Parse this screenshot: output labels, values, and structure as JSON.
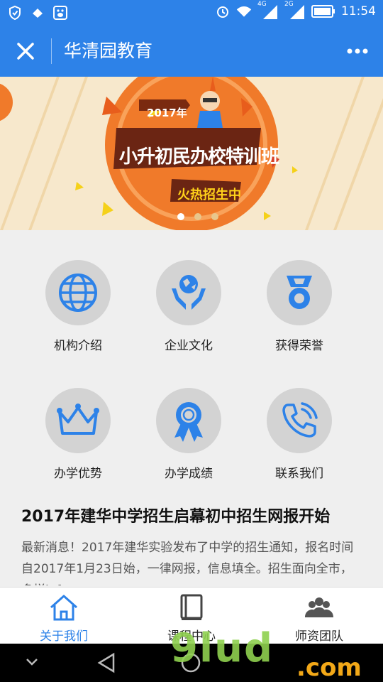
{
  "status_bar": {
    "time": "11:54",
    "network_1": "4G",
    "network_2": "2G",
    "icons": [
      "shield-icon",
      "notification-icon",
      "baidu-icon",
      "alarm-icon",
      "wifi-icon",
      "signal-icon",
      "battery-icon"
    ]
  },
  "app_bar": {
    "title": "华清园教育",
    "close_icon": "close-icon",
    "more_icon": "more-icon",
    "color": "#2d82e8"
  },
  "banner": {
    "year": "2017年",
    "headline": "小升初民办校特训班",
    "tag": "火热招生中",
    "slides": 3,
    "active_slide": 1
  },
  "features": [
    {
      "label": "机构介绍",
      "icon": "globe-icon"
    },
    {
      "label": "企业文化",
      "icon": "hands-globe-icon"
    },
    {
      "label": "获得荣誉",
      "icon": "medal-icon"
    },
    {
      "label": "办学优势",
      "icon": "crown-icon"
    },
    {
      "label": "办学成绩",
      "icon": "award-ribbon-icon"
    },
    {
      "label": "联系我们",
      "icon": "phone-icon"
    }
  ],
  "news": {
    "title": "2017年建华中学招生启幕初中招生网报开始",
    "body": "最新消息！2017年建华实验发布了中学的招生通知，报名时间自2017年1月23日始，一律网报，信息填全。招生面向全市，多样info..."
  },
  "tabs": [
    {
      "label": "关于我们",
      "icon": "home-icon",
      "active": true
    },
    {
      "label": "课程中心",
      "icon": "book-icon",
      "active": false
    },
    {
      "label": "师资团队",
      "icon": "team-icon",
      "active": false
    }
  ],
  "watermark": {
    "text": "9lud",
    "suffix": ".com"
  },
  "colors": {
    "accent": "#2d82e8",
    "icon_circle": "#d3d3d3",
    "background": "#efefef"
  }
}
